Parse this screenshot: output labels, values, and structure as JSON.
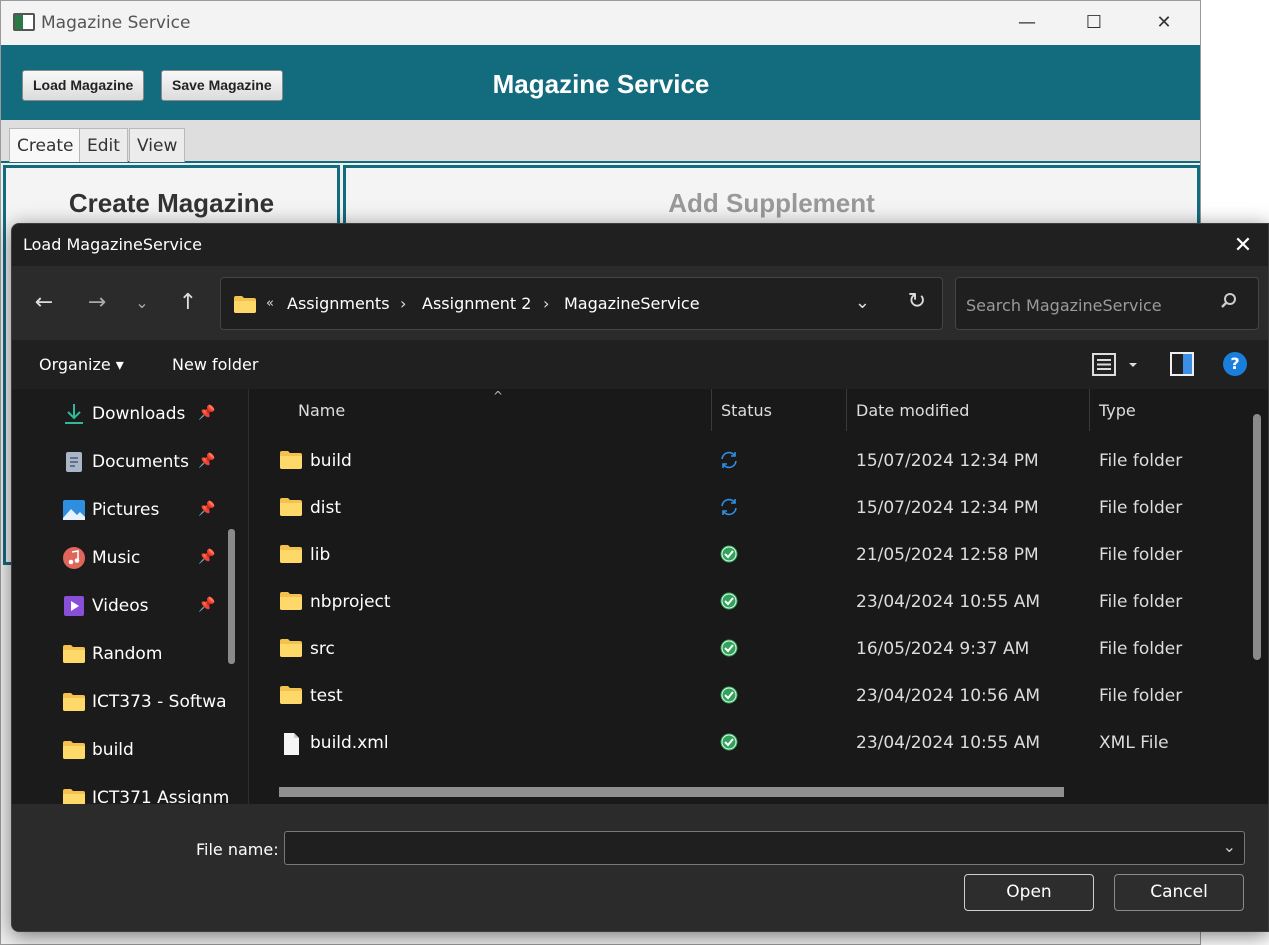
{
  "app": {
    "window_title": "Magazine Service",
    "header_title": "Magazine Service",
    "load_button": "Load Magazine",
    "save_button": "Save Magazine",
    "tabs": [
      {
        "label": "Create",
        "active": true
      },
      {
        "label": "Edit",
        "active": false
      },
      {
        "label": "View",
        "active": false
      }
    ],
    "left_pane_title": "Create Magazine",
    "right_pane_title": "Add Supplement",
    "accent_color": "#136b7e"
  },
  "dialog": {
    "title": "Load MagazineService",
    "breadcrumb_prefix": "«",
    "breadcrumb": [
      "Assignments",
      "Assignment 2",
      "MagazineService"
    ],
    "search_placeholder": "Search MagazineService",
    "toolbar": {
      "organize": "Organize ▾",
      "new_folder": "New folder"
    },
    "nav_items": [
      {
        "label": "Downloads",
        "icon": "download-icon",
        "pinned": true
      },
      {
        "label": "Documents",
        "icon": "documents-icon",
        "pinned": true
      },
      {
        "label": "Pictures",
        "icon": "pictures-icon",
        "pinned": true
      },
      {
        "label": "Music",
        "icon": "music-icon",
        "pinned": true
      },
      {
        "label": "Videos",
        "icon": "videos-icon",
        "pinned": true
      },
      {
        "label": "Random",
        "icon": "folder-icon",
        "pinned": false
      },
      {
        "label": "ICT373 - Softwa",
        "icon": "folder-icon",
        "pinned": false
      },
      {
        "label": "build",
        "icon": "folder-icon",
        "pinned": false
      },
      {
        "label": "ICT371 Assignm",
        "icon": "folder-icon",
        "pinned": false
      }
    ],
    "columns": {
      "name": "Name",
      "status": "Status",
      "date": "Date modified",
      "type": "Type"
    },
    "files": [
      {
        "name": "build",
        "status": "syncing",
        "date": "15/07/2024 12:34 PM",
        "type": "File folder",
        "kind": "folder"
      },
      {
        "name": "dist",
        "status": "syncing",
        "date": "15/07/2024 12:34 PM",
        "type": "File folder",
        "kind": "folder"
      },
      {
        "name": "lib",
        "status": "synced",
        "date": "21/05/2024 12:58 PM",
        "type": "File folder",
        "kind": "folder"
      },
      {
        "name": "nbproject",
        "status": "synced",
        "date": "23/04/2024 10:55 AM",
        "type": "File folder",
        "kind": "folder"
      },
      {
        "name": "src",
        "status": "synced",
        "date": "16/05/2024 9:37 AM",
        "type": "File folder",
        "kind": "folder"
      },
      {
        "name": "test",
        "status": "synced",
        "date": "23/04/2024 10:56 AM",
        "type": "File folder",
        "kind": "folder"
      },
      {
        "name": "build.xml",
        "status": "synced",
        "date": "23/04/2024 10:55 AM",
        "type": "XML File",
        "kind": "file"
      }
    ],
    "file_name_label": "File name:",
    "file_name_value": "",
    "open_button": "Open",
    "cancel_button": "Cancel"
  }
}
